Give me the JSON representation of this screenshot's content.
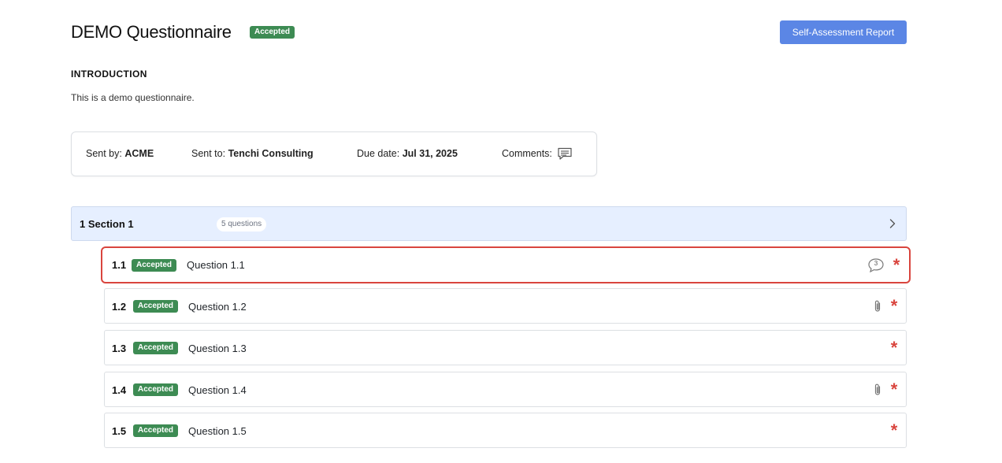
{
  "header": {
    "title": "DEMO Questionnaire",
    "status": "Accepted",
    "report_button": "Self-Assessment Report"
  },
  "intro": {
    "heading": "INTRODUCTION",
    "text": "This is a demo questionnaire."
  },
  "info": {
    "sent_by_label": "Sent by:",
    "sent_by": "ACME",
    "sent_to_label": "Sent to:",
    "sent_to": "Tenchi Consulting",
    "due_label": "Due date:",
    "due": "Jul 31, 2025",
    "comments_label": "Comments:",
    "comments_icon": "comment-lines-icon"
  },
  "section": {
    "title": "1 Section 1",
    "count": "5 questions",
    "chevron_icon": "chevron-right-icon"
  },
  "questions": [
    {
      "num": "1.1",
      "status": "Accepted",
      "label": "Question 1.1",
      "comment_count": "3",
      "selected": true
    },
    {
      "num": "1.2",
      "status": "Accepted",
      "label": "Question 1.2",
      "attachment_icon": "paperclip-icon"
    },
    {
      "num": "1.3",
      "status": "Accepted",
      "label": "Question 1.3"
    },
    {
      "num": "1.4",
      "status": "Accepted",
      "label": "Question 1.4",
      "attachment_icon": "paperclip-icon"
    },
    {
      "num": "1.5",
      "status": "Accepted",
      "label": "Question 1.5"
    }
  ],
  "required_marker": "*",
  "colors": {
    "accepted_badge": "#3d8b53",
    "primary_button": "#5b86e5",
    "section_bg": "#e6efff",
    "required": "#d9453e",
    "selected_border": "#d9453e"
  }
}
